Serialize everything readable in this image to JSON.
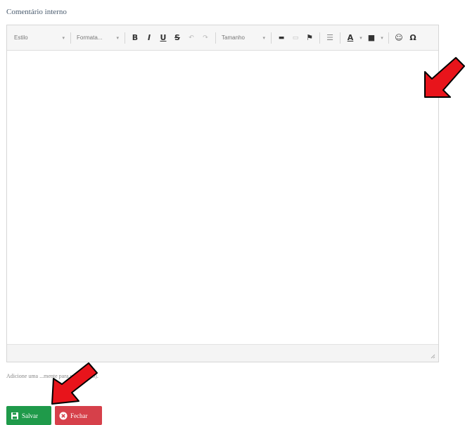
{
  "form": {
    "label": "Comentário interno",
    "help_text": "Adicione uma ...mente para uso interno)."
  },
  "toolbar": {
    "font_select": "Estilo",
    "format_select": "Formata...",
    "size_select": "Tamanho",
    "bold": "B",
    "italic": "I",
    "underline": "U",
    "strike": "S",
    "undo": "↶",
    "redo": "↷",
    "link": "▬",
    "unlink": "▭",
    "flag": "⚑",
    "hr": "☰",
    "text_color": "A",
    "bg_color": "■",
    "emoji": "☺",
    "special_char": "Ω",
    "caret": "▾"
  },
  "buttons": {
    "save": "Salvar",
    "close": "Fechar"
  },
  "colors": {
    "save": "#1f9a4a",
    "close": "#d6404a",
    "annotation_arrow": "#e8141b"
  },
  "icons": [
    "save-icon",
    "close-circle-icon",
    "resize-handle-icon",
    "red-arrow-annotation"
  ]
}
